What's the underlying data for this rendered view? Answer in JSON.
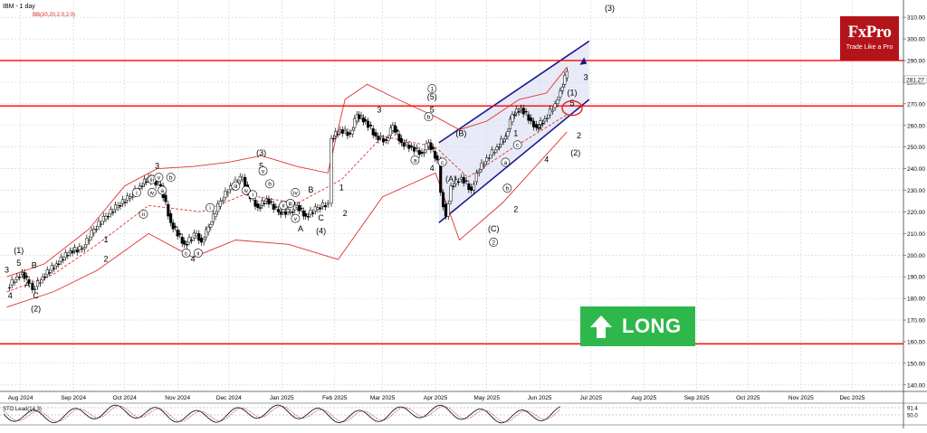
{
  "header": {
    "ticker_title": "IBM - 1 day",
    "indicator_label": "BB(20,20,2.0,2.0)"
  },
  "logo": {
    "brand": "FxPro",
    "tagline": "Trade Like a Pro"
  },
  "signal": {
    "label": "LONG",
    "color": "#2eb84b"
  },
  "oscillator": {
    "label": "STO Lead(14,3)",
    "values": [
      "91.4",
      "50.0"
    ]
  },
  "colors": {
    "band": "#e03030",
    "level_line": "#ff0000",
    "channel": "#1a1a8c",
    "channel_fill": "#d9dcf2",
    "candle": "#000000",
    "logo_bg": "#b3141a"
  },
  "chart_data": {
    "type": "candlestick",
    "ylim": [
      137,
      318
    ],
    "y_ticks": [
      140,
      150,
      160,
      170,
      180,
      190,
      200,
      210,
      220,
      230,
      240,
      250,
      260,
      270,
      280,
      290,
      300,
      310
    ],
    "x_ticks": [
      "Aug 2024",
      "Sep 2024",
      "Oct 2024",
      "Nov 2024",
      "Dec 2024",
      "Jan 2025",
      "Feb 2025",
      "Mar 2025",
      "Apr 2025",
      "May 2025",
      "Jun 2025",
      "Jul 2025",
      "Aug 2025",
      "Sep 2025",
      "Oct 2025",
      "Nov 2025",
      "Dec 2025"
    ],
    "last_price": "281.27",
    "horizontal_levels": [
      290,
      269,
      159
    ],
    "price": [
      {
        "date": "2024-07-24",
        "close": 185
      },
      {
        "date": "2024-07-30",
        "close": 190
      },
      {
        "date": "2024-08-02",
        "close": 192
      },
      {
        "date": "2024-08-06",
        "close": 187
      },
      {
        "date": "2024-08-08",
        "close": 184
      },
      {
        "date": "2024-08-14",
        "close": 190
      },
      {
        "date": "2024-08-22",
        "close": 196
      },
      {
        "date": "2024-08-30",
        "close": 202
      },
      {
        "date": "2024-09-06",
        "close": 203
      },
      {
        "date": "2024-09-13",
        "close": 212
      },
      {
        "date": "2024-09-20",
        "close": 218
      },
      {
        "date": "2024-09-27",
        "close": 223
      },
      {
        "date": "2024-10-04",
        "close": 227
      },
      {
        "date": "2024-10-10",
        "close": 232
      },
      {
        "date": "2024-10-15",
        "close": 236
      },
      {
        "date": "2024-10-22",
        "close": 232
      },
      {
        "date": "2024-10-28",
        "close": 215
      },
      {
        "date": "2024-11-05",
        "close": 205
      },
      {
        "date": "2024-11-12",
        "close": 210
      },
      {
        "date": "2024-11-15",
        "close": 206
      },
      {
        "date": "2024-11-19",
        "close": 213
      },
      {
        "date": "2024-11-26",
        "close": 225
      },
      {
        "date": "2024-12-02",
        "close": 232
      },
      {
        "date": "2024-12-09",
        "close": 236
      },
      {
        "date": "2024-12-12",
        "close": 229
      },
      {
        "date": "2024-12-18",
        "close": 222
      },
      {
        "date": "2024-12-23",
        "close": 226
      },
      {
        "date": "2024-12-30",
        "close": 220
      },
      {
        "date": "2025-01-06",
        "close": 220
      },
      {
        "date": "2025-01-10",
        "close": 223
      },
      {
        "date": "2025-01-15",
        "close": 218
      },
      {
        "date": "2025-01-22",
        "close": 222
      },
      {
        "date": "2025-01-28",
        "close": 224
      },
      {
        "date": "2025-01-30",
        "close": 254
      },
      {
        "date": "2025-02-04",
        "close": 258
      },
      {
        "date": "2025-02-10",
        "close": 256
      },
      {
        "date": "2025-02-14",
        "close": 265
      },
      {
        "date": "2025-02-19",
        "close": 262
      },
      {
        "date": "2025-02-25",
        "close": 255
      },
      {
        "date": "2025-03-03",
        "close": 253
      },
      {
        "date": "2025-03-07",
        "close": 260
      },
      {
        "date": "2025-03-12",
        "close": 252
      },
      {
        "date": "2025-03-18",
        "close": 250
      },
      {
        "date": "2025-03-24",
        "close": 247
      },
      {
        "date": "2025-03-28",
        "close": 252
      },
      {
        "date": "2025-04-02",
        "close": 244
      },
      {
        "date": "2025-04-04",
        "close": 229
      },
      {
        "date": "2025-04-07",
        "close": 218
      },
      {
        "date": "2025-04-10",
        "close": 232
      },
      {
        "date": "2025-04-16",
        "close": 236
      },
      {
        "date": "2025-04-22",
        "close": 230
      },
      {
        "date": "2025-04-25",
        "close": 238
      },
      {
        "date": "2025-05-01",
        "close": 245
      },
      {
        "date": "2025-05-07",
        "close": 250
      },
      {
        "date": "2025-05-12",
        "close": 255
      },
      {
        "date": "2025-05-16",
        "close": 265
      },
      {
        "date": "2025-05-21",
        "close": 268
      },
      {
        "date": "2025-05-27",
        "close": 262
      },
      {
        "date": "2025-05-30",
        "close": 259
      },
      {
        "date": "2025-06-04",
        "close": 263
      },
      {
        "date": "2025-06-10",
        "close": 270
      },
      {
        "date": "2025-06-13",
        "close": 276
      },
      {
        "date": "2025-06-17",
        "close": 285
      }
    ],
    "bollinger_upper": [
      {
        "date": "2024-07-24",
        "v": 190
      },
      {
        "date": "2024-08-15",
        "v": 196
      },
      {
        "date": "2024-09-10",
        "v": 212
      },
      {
        "date": "2024-10-01",
        "v": 232
      },
      {
        "date": "2024-10-20",
        "v": 240
      },
      {
        "date": "2024-11-10",
        "v": 241
      },
      {
        "date": "2024-12-01",
        "v": 243
      },
      {
        "date": "2024-12-20",
        "v": 246
      },
      {
        "date": "2025-01-10",
        "v": 241
      },
      {
        "date": "2025-01-28",
        "v": 238
      },
      {
        "date": "2025-02-07",
        "v": 272
      },
      {
        "date": "2025-02-20",
        "v": 279
      },
      {
        "date": "2025-03-10",
        "v": 272
      },
      {
        "date": "2025-04-01",
        "v": 264
      },
      {
        "date": "2025-04-15",
        "v": 258
      },
      {
        "date": "2025-05-01",
        "v": 262
      },
      {
        "date": "2025-05-20",
        "v": 272
      },
      {
        "date": "2025-06-05",
        "v": 275
      },
      {
        "date": "2025-06-17",
        "v": 287
      }
    ],
    "bollinger_middle": [
      {
        "date": "2024-07-24",
        "v": 183
      },
      {
        "date": "2024-08-20",
        "v": 191
      },
      {
        "date": "2024-09-15",
        "v": 205
      },
      {
        "date": "2024-10-15",
        "v": 223
      },
      {
        "date": "2024-11-15",
        "v": 220
      },
      {
        "date": "2024-12-10",
        "v": 228
      },
      {
        "date": "2025-01-10",
        "v": 224
      },
      {
        "date": "2025-02-05",
        "v": 235
      },
      {
        "date": "2025-03-01",
        "v": 255
      },
      {
        "date": "2025-04-01",
        "v": 250
      },
      {
        "date": "2025-04-20",
        "v": 236
      },
      {
        "date": "2025-05-15",
        "v": 249
      },
      {
        "date": "2025-06-17",
        "v": 265
      }
    ],
    "bollinger_lower": [
      {
        "date": "2024-07-24",
        "v": 176
      },
      {
        "date": "2024-08-20",
        "v": 183
      },
      {
        "date": "2024-09-15",
        "v": 193
      },
      {
        "date": "2024-10-15",
        "v": 210
      },
      {
        "date": "2024-11-10",
        "v": 199
      },
      {
        "date": "2024-12-05",
        "v": 207
      },
      {
        "date": "2025-01-05",
        "v": 205
      },
      {
        "date": "2025-02-03",
        "v": 198
      },
      {
        "date": "2025-03-01",
        "v": 227
      },
      {
        "date": "2025-04-01",
        "v": 238
      },
      {
        "date": "2025-04-15",
        "v": 207
      },
      {
        "date": "2025-05-10",
        "v": 224
      },
      {
        "date": "2025-06-17",
        "v": 257
      }
    ],
    "channel": {
      "upper": [
        {
          "date": "2025-04-03",
          "v": 252
        },
        {
          "date": "2025-06-30",
          "v": 299
        }
      ],
      "lower": [
        {
          "date": "2025-04-03",
          "v": 215
        },
        {
          "date": "2025-06-30",
          "v": 272
        }
      ]
    },
    "wave_labels": [
      {
        "text": "3",
        "date": "2024-07-24",
        "v": 192
      },
      {
        "text": "(1)",
        "date": "2024-07-31",
        "v": 201
      },
      {
        "text": "5",
        "date": "2024-07-31",
        "v": 195
      },
      {
        "text": "4",
        "date": "2024-07-26",
        "v": 180
      },
      {
        "text": "A",
        "date": "2024-08-05",
        "v": 185
      },
      {
        "text": "B",
        "date": "2024-08-09",
        "v": 194
      },
      {
        "text": "C",
        "date": "2024-08-10",
        "v": 180
      },
      {
        "text": "(2)",
        "date": "2024-08-10",
        "v": 174
      },
      {
        "text": "1",
        "date": "2024-09-20",
        "v": 206
      },
      {
        "text": "2",
        "date": "2024-09-20",
        "v": 197
      },
      {
        "text": "3",
        "date": "2024-10-20",
        "v": 240
      },
      {
        "text": "4",
        "date": "2024-11-10",
        "v": 197
      },
      {
        "text": "(3)",
        "date": "2024-12-20",
        "v": 246
      },
      {
        "text": "5",
        "date": "2024-12-20",
        "v": 240
      },
      {
        "text": "B",
        "date": "2025-01-18",
        "v": 229
      },
      {
        "text": "A",
        "date": "2025-01-12",
        "v": 211
      },
      {
        "text": "C",
        "date": "2025-01-24",
        "v": 216
      },
      {
        "text": "(4)",
        "date": "2025-01-24",
        "v": 210
      },
      {
        "text": "1",
        "date": "2025-02-05",
        "v": 230
      },
      {
        "text": "2",
        "date": "2025-02-07",
        "v": 218
      },
      {
        "text": "3",
        "date": "2025-02-27",
        "v": 266
      },
      {
        "text": "(5)",
        "date": "2025-03-30",
        "v": 272
      },
      {
        "text": "5",
        "date": "2025-03-30",
        "v": 266
      },
      {
        "text": "4",
        "date": "2025-03-30",
        "v": 239
      },
      {
        "text": "(A)",
        "date": "2025-04-10",
        "v": 234
      },
      {
        "text": "(B)",
        "date": "2025-04-16",
        "v": 255
      },
      {
        "text": "(C)",
        "date": "2025-05-05",
        "v": 211
      },
      {
        "text": "1",
        "date": "2025-05-18",
        "v": 255
      },
      {
        "text": "2",
        "date": "2025-05-18",
        "v": 220
      },
      {
        "text": "3",
        "date": "2025-06-01",
        "v": 258
      },
      {
        "text": "4",
        "date": "2025-06-05",
        "v": 243
      },
      {
        "text": "(1)",
        "date": "2025-06-20",
        "v": 274
      },
      {
        "text": "5",
        "date": "2025-06-20",
        "v": 269
      },
      {
        "text": "(2)",
        "date": "2025-06-22",
        "v": 246
      },
      {
        "text": "2",
        "date": "2025-06-24",
        "v": 254
      },
      {
        "text": "3",
        "date": "2025-06-28",
        "v": 281
      },
      {
        "text": "(3)",
        "date": "2025-07-12",
        "v": 313
      }
    ],
    "circled_labels": [
      {
        "text": "i",
        "date": "2024-10-08",
        "v": 229
      },
      {
        "text": "ii",
        "date": "2024-10-12",
        "v": 219
      },
      {
        "text": "iii",
        "date": "2024-10-17",
        "v": 235
      },
      {
        "text": "iv",
        "date": "2024-10-17",
        "v": 229
      },
      {
        "text": "v",
        "date": "2024-10-21",
        "v": 236
      },
      {
        "text": "a",
        "date": "2024-10-23",
        "v": 230
      },
      {
        "text": "b",
        "date": "2024-10-28",
        "v": 236
      },
      {
        "text": "c",
        "date": "2024-11-06",
        "v": 201
      },
      {
        "text": "i",
        "date": "2024-11-20",
        "v": 222
      },
      {
        "text": "ii",
        "date": "2024-11-13",
        "v": 201
      },
      {
        "text": "iii",
        "date": "2024-12-05",
        "v": 232
      },
      {
        "text": "iv",
        "date": "2024-12-11",
        "v": 230
      },
      {
        "text": "i",
        "date": "2024-12-15",
        "v": 228
      },
      {
        "text": "v",
        "date": "2024-12-21",
        "v": 239
      },
      {
        "text": "b",
        "date": "2024-12-25",
        "v": 233
      },
      {
        "text": "ii",
        "date": "2025-01-02",
        "v": 223
      },
      {
        "text": "iii",
        "date": "2025-01-06",
        "v": 224
      },
      {
        "text": "iv",
        "date": "2025-01-09",
        "v": 229
      },
      {
        "text": "v",
        "date": "2025-01-09",
        "v": 217
      },
      {
        "text": "1",
        "date": "2025-03-30",
        "v": 277
      },
      {
        "text": "a",
        "date": "2025-03-20",
        "v": 244
      },
      {
        "text": "b",
        "date": "2025-03-28",
        "v": 264
      },
      {
        "text": "c",
        "date": "2025-04-05",
        "v": 243
      },
      {
        "text": "2",
        "date": "2025-05-05",
        "v": 206
      },
      {
        "text": "a",
        "date": "2025-05-12",
        "v": 243
      },
      {
        "text": "b",
        "date": "2025-05-13",
        "v": 231
      },
      {
        "text": "c",
        "date": "2025-05-19",
        "v": 251
      }
    ]
  }
}
